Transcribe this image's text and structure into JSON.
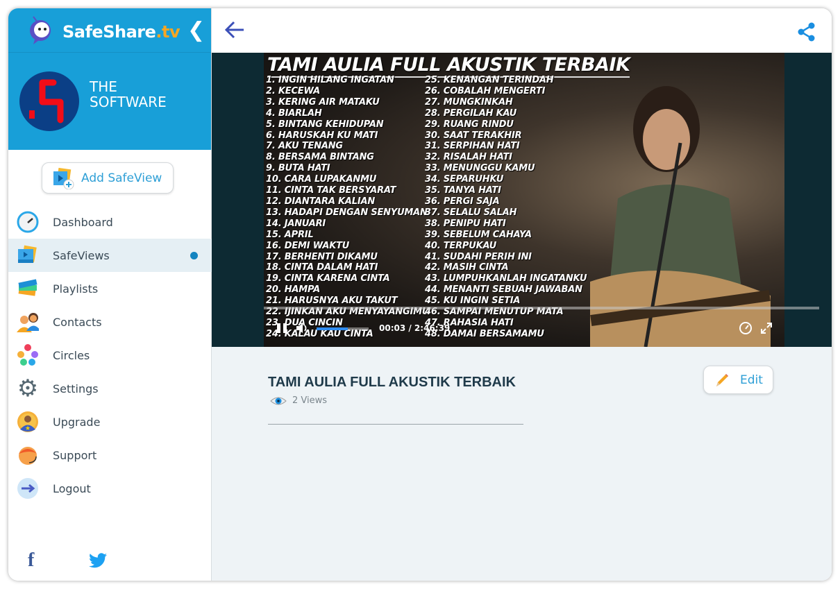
{
  "brand": {
    "name": "SafeShare",
    "tld": ".tv",
    "collapse_icon": "chevron-left-icon"
  },
  "profile": {
    "name": "THE SOFTWARE"
  },
  "add_button": {
    "label": "Add SafeView"
  },
  "nav": {
    "items": [
      {
        "label": "Dashboard",
        "icon": "dashboard-gauge-icon"
      },
      {
        "label": "SafeViews",
        "icon": "safeviews-icon",
        "active": true
      },
      {
        "label": "Playlists",
        "icon": "playlists-icon"
      },
      {
        "label": "Contacts",
        "icon": "contacts-icon"
      },
      {
        "label": "Circles",
        "icon": "circles-icon"
      },
      {
        "label": "Settings",
        "icon": "gear-icon"
      },
      {
        "label": "Upgrade",
        "icon": "upgrade-icon"
      },
      {
        "label": "Support",
        "icon": "support-icon"
      },
      {
        "label": "Logout",
        "icon": "logout-icon"
      }
    ]
  },
  "social": {
    "facebook": "f",
    "twitter": "twitter-icon"
  },
  "video": {
    "frame_title": "TAMI AULIA FULL AKUSTIK TERBAIK",
    "songs_left": [
      "1. INGIN HILANG INGATAN",
      "2. KECEWA",
      "3. KERING AIR MATAKU",
      "4. BIARLAH",
      "5. BINTANG KEHIDUPAN",
      "6. HARUSKAH KU MATI",
      "7. AKU TENANG",
      "8. BERSAMA BINTANG",
      "9. BUTA HATI",
      "10. CARA LUPAKANMU",
      "11. CINTA TAK BERSYARAT",
      "12. DIANTARA KALIAN",
      "13. HADAPI DENGAN SENYUMAN",
      "14. JANUARI",
      "15. APRIL",
      "16. DEMI WAKTU",
      "17. BERHENTI DIKAMU",
      "18. CINTA DALAM HATI",
      "19. CINTA KARENA CINTA",
      "20. HAMPA",
      "21. HARUSNYA AKU TAKUT",
      "22. IJINKAN AKU MENYAYANGIMU",
      "23. DUA CINCIN",
      "24. KALAU KAU CINTA"
    ],
    "songs_right": [
      "25. KENANGAN TERINDAH",
      "26. COBALAH MENGERTI",
      "27. MUNGKINKAH",
      "28. PERGILAH KAU",
      "29. RUANG RINDU",
      "30. SAAT TERAKHIR",
      "31. SERPIHAN HATI",
      "32. RISALAH HATI",
      "33. MENUNGGU KAMU",
      "34. SEPARUHKU",
      "35. TANYA HATI",
      "36. PERGI SAJA",
      "37. SELALU SALAH",
      "38. PENIPU HATI",
      "39. SEBELUM CAHAYA",
      "40. TERPUKAU",
      "41. SUDAHI PERIH INI",
      "42. MASIH CINTA",
      "43. LUMPUHKANLAH INGATANKU",
      "44. MENANTI SEBUAH JAWABAN",
      "45. KU INGIN SETIA",
      "46. SAMPAI MENUTUP MATA",
      "47. RAHASIA HATI",
      "48. DAMAI BERSAMAMU"
    ],
    "time": "00:03 / 2:46:39",
    "volume_percent": 60,
    "accent": "#2f8cf0"
  },
  "content": {
    "title": "TAMI AULIA FULL AKUSTIK TERBAIK",
    "views": "2 Views",
    "edit_label": "Edit"
  },
  "colors": {
    "brand": "#189fd8",
    "accent": "#2e9fd6",
    "orange": "#f5a623"
  }
}
